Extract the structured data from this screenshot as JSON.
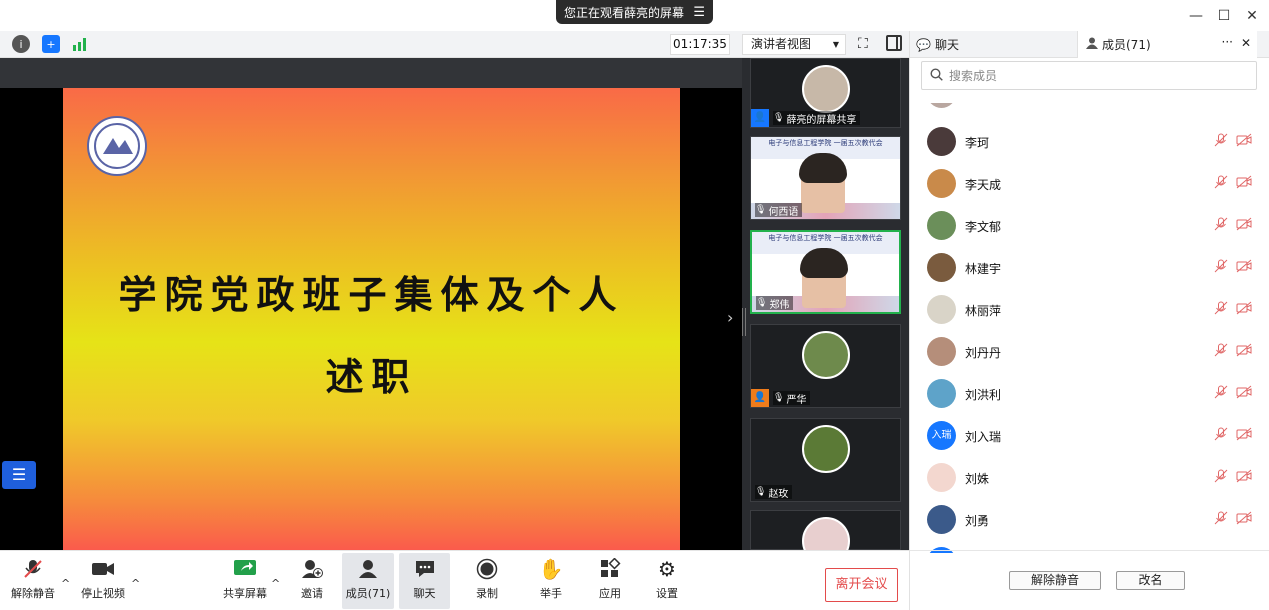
{
  "title_bar": {
    "share_banner": "您正在观看薛亮的屏幕",
    "share_menu_icon": "menu-icon",
    "window_controls": [
      "minimize-icon",
      "maximize-icon",
      "close-icon"
    ]
  },
  "toolbar": {
    "timer": "01:17:35",
    "view_mode": "演讲者视图",
    "icons": [
      "info-icon",
      "shield-icon",
      "signal-icon",
      "fullscreen-icon",
      "side-panel-icon"
    ]
  },
  "slide": {
    "title_line1": "学院党政班子集体及个人",
    "title_line2": "述职"
  },
  "tiles": [
    {
      "name": "薛亮的屏幕共享",
      "type": "avatar",
      "color": "#c7b8a8",
      "has_badge": true,
      "badge_color": "#1677ff"
    },
    {
      "name": "何西语",
      "type": "video",
      "banner": "电子与信息工程学院 一届五次教代会"
    },
    {
      "name": "郑伟",
      "type": "video",
      "banner": "电子与信息工程学院 一届五次教代会",
      "active": true
    },
    {
      "name": "严华",
      "type": "avatar",
      "color": "#6e8a4c",
      "has_badge": true,
      "badge_color": "#f07c1b"
    },
    {
      "name": "赵玫",
      "type": "avatar",
      "color": "#5b7a36",
      "has_badge": false
    },
    {
      "name": "",
      "type": "avatar",
      "color": "#e8cfcf",
      "has_badge": false
    }
  ],
  "bottom_bar": {
    "mute": "解除静音",
    "video": "停止视频",
    "share": "共享屏幕",
    "invite": "邀请",
    "members": "成员(71)",
    "chat": "聊天",
    "record": "录制",
    "raise_hand": "举手",
    "apps": "应用",
    "settings": "设置",
    "leave": "离开会议"
  },
  "panel": {
    "tab_chat": "聊天",
    "tab_members": "成员(71)",
    "search_placeholder": "搜索成员",
    "members": [
      {
        "name": "李珂",
        "color": "#4a3a3a"
      },
      {
        "name": "李天成",
        "color": "#c98a4a"
      },
      {
        "name": "李文郁",
        "color": "#6b8f5a"
      },
      {
        "name": "林建宇",
        "color": "#7a5b3e"
      },
      {
        "name": "林丽萍",
        "color": "#d9d4c8"
      },
      {
        "name": "刘丹丹",
        "color": "#b58e7a"
      },
      {
        "name": "刘洪利",
        "color": "#5ea3c9"
      },
      {
        "name": "刘入瑞",
        "color": "#1677ff",
        "initials": "入瑞"
      },
      {
        "name": "刘姝",
        "color": "#f3d7cf"
      },
      {
        "name": "刘勇",
        "color": "#3b5a8a"
      }
    ],
    "unmute_all": "解除静音",
    "rename": "改名"
  }
}
